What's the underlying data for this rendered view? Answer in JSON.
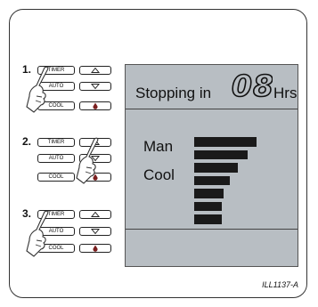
{
  "steps": [
    {
      "number": "1.",
      "buttons": {
        "timer": "TIMER",
        "auto": "AUTO",
        "cool": "COOL"
      }
    },
    {
      "number": "2.",
      "buttons": {
        "timer": "TIMER",
        "auto": "AUTO",
        "cool": "COOL"
      }
    },
    {
      "number": "3.",
      "buttons": {
        "timer": "TIMER",
        "auto": "AUTO",
        "cool": "COOL"
      }
    }
  ],
  "display": {
    "stopping_label": "Stopping in",
    "hours_value": "08",
    "hours_unit": "Hrs",
    "mode_label": "Man",
    "function_label": "Cool",
    "fan_speed_level": 7
  },
  "figure_code": "ILL1137-A",
  "icons": {
    "up": "triangle-up-icon",
    "down": "triangle-down-icon",
    "temp": "droplet-icon",
    "pointer": "pointing-hand-icon"
  }
}
